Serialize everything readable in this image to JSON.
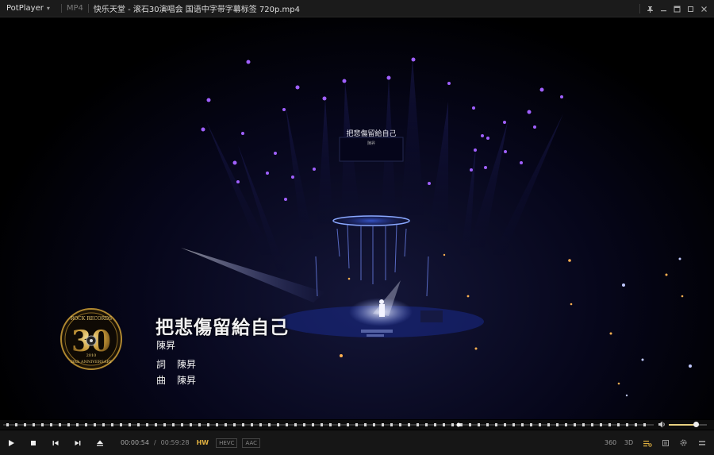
{
  "titlebar": {
    "app_name": "PotPlayer",
    "format": "MP4",
    "file_title": "快乐天堂 - 滚石30演唱会 国语中字带字幕标签 720p.mp4",
    "buttons": [
      "pin-icon",
      "minimize-icon",
      "mini-mode-icon",
      "maximize-icon",
      "close-icon"
    ]
  },
  "video": {
    "stage_sign_title": "把悲傷留給自己",
    "stage_sign_sub": "陳昇",
    "logo": {
      "top_text": "ROCK RECORDS",
      "number": "30",
      "year": "2010",
      "bottom_text": "30th ANNIVERSARY"
    },
    "song_title": "把悲傷留給自己",
    "singer": "陳昇",
    "lyric_label": "詞",
    "lyricist": "陳昇",
    "music_label": "曲",
    "composer": "陳昇"
  },
  "seek": {
    "progress_fraction": 0.0,
    "volume_fraction": 0.72
  },
  "controls": {
    "buttons": [
      "play-icon",
      "stop-icon",
      "previous-icon",
      "next-icon",
      "eject-icon"
    ],
    "current_time": "00:00:54",
    "total_time": "00:59:28",
    "time_sep": "/",
    "badge_hw": "HW",
    "badge_codec": "HEVC",
    "badge_audio": "AAC",
    "right_buttons": {
      "vr": "360",
      "d3": "3D"
    }
  },
  "colors": {
    "accent": "#e0b040",
    "seek_fill": "#e8d080",
    "titlebar_bg": "#1b1b1b",
    "controls_bg": "#161616"
  }
}
